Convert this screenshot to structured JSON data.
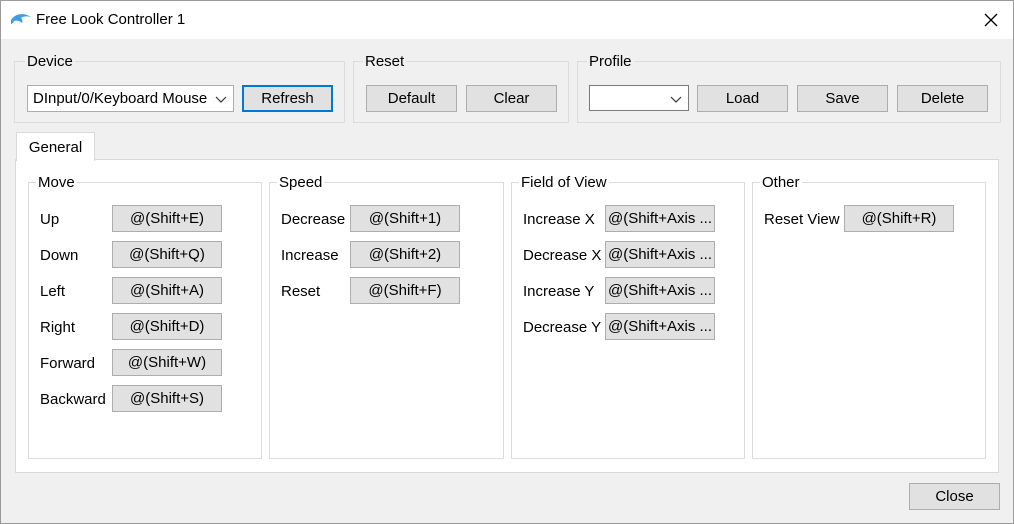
{
  "window": {
    "title": "Free Look Controller 1"
  },
  "device": {
    "label": "Device",
    "selected": "DInput/0/Keyboard Mouse",
    "refresh_label": "Refresh"
  },
  "reset": {
    "label": "Reset",
    "default_label": "Default",
    "clear_label": "Clear"
  },
  "profile": {
    "label": "Profile",
    "selected": "",
    "load_label": "Load",
    "save_label": "Save",
    "delete_label": "Delete"
  },
  "tabs": [
    {
      "label": "General"
    }
  ],
  "groups": {
    "move": {
      "label": "Move",
      "rows": [
        {
          "label": "Up",
          "binding": "@(Shift+E)"
        },
        {
          "label": "Down",
          "binding": "@(Shift+Q)"
        },
        {
          "label": "Left",
          "binding": "@(Shift+A)"
        },
        {
          "label": "Right",
          "binding": "@(Shift+D)"
        },
        {
          "label": "Forward",
          "binding": "@(Shift+W)"
        },
        {
          "label": "Backward",
          "binding": "@(Shift+S)"
        }
      ]
    },
    "speed": {
      "label": "Speed",
      "rows": [
        {
          "label": "Decrease",
          "binding": "@(Shift+1)"
        },
        {
          "label": "Increase",
          "binding": "@(Shift+2)"
        },
        {
          "label": "Reset",
          "binding": "@(Shift+F)"
        }
      ]
    },
    "fov": {
      "label": "Field of View",
      "rows": [
        {
          "label": "Increase X",
          "binding": "@(Shift+Axis ..."
        },
        {
          "label": "Decrease X",
          "binding": "@(Shift+Axis ..."
        },
        {
          "label": "Increase Y",
          "binding": "@(Shift+Axis ..."
        },
        {
          "label": "Decrease Y",
          "binding": "@(Shift+Axis ..."
        }
      ]
    },
    "other": {
      "label": "Other",
      "rows": [
        {
          "label": "Reset View",
          "binding": "@(Shift+R)"
        }
      ]
    }
  },
  "footer": {
    "close_label": "Close"
  },
  "icons": {
    "app": "dolphin-icon",
    "window_close": "close-icon",
    "dropdown": "chevron-down-icon"
  },
  "colors": {
    "focus_border": "#0078d7",
    "button_bg": "#e1e1e1"
  }
}
